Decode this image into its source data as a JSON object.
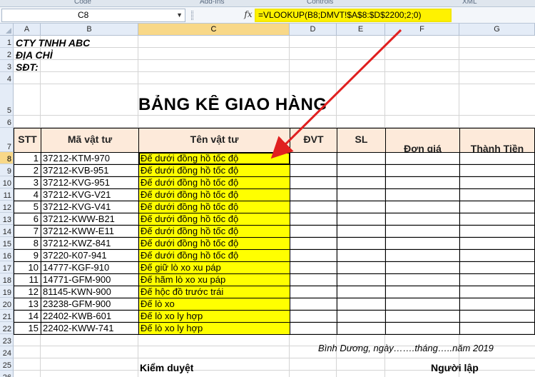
{
  "ribbon": {
    "groups": [
      "Code",
      "Add-Ins",
      "Controls",
      "XML"
    ]
  },
  "formula_bar": {
    "name_box": "C8",
    "fx_label": "fx",
    "formula": "=VLOOKUP(B8;DMVT!$A$8:$D$2200;2;0)"
  },
  "columns": [
    "A",
    "B",
    "C",
    "D",
    "E",
    "F",
    "G"
  ],
  "rows": [
    "1",
    "2",
    "3",
    "4",
    "5",
    "6",
    "7",
    "8",
    "9",
    "10",
    "11",
    "12",
    "13",
    "14",
    "15",
    "16",
    "17",
    "18",
    "19",
    "20",
    "21",
    "22",
    "23",
    "24",
    "25",
    "26"
  ],
  "company": {
    "name": "CTY TNHH ABC",
    "address": "ĐỊA CHỈ",
    "phone": "SĐT:"
  },
  "title": "BẢNG KÊ GIAO HÀNG",
  "table_headers": {
    "stt": "STT",
    "code": "Mã vật tư",
    "name": "Tên vật tư",
    "unit": "ĐVT",
    "qty": "SL",
    "price": "Đơn giá",
    "total": "Thành Tiền"
  },
  "items": [
    {
      "stt": "1",
      "code": "37212-KTM-970",
      "name": "Đế dưới đồng hồ tốc độ"
    },
    {
      "stt": "2",
      "code": "37212-KVB-951",
      "name": "Đế dưới đồng hồ tốc độ"
    },
    {
      "stt": "3",
      "code": "37212-KVG-951",
      "name": "Đế dưới đồng hồ tốc độ"
    },
    {
      "stt": "4",
      "code": "37212-KVG-V21",
      "name": "Đế dưới đồng hồ tốc độ"
    },
    {
      "stt": "5",
      "code": "37212-KVG-V41",
      "name": "Đế dưới đồng hồ tốc độ"
    },
    {
      "stt": "6",
      "code": "37212-KWW-B21",
      "name": "Đế dưới đồng hồ tốc độ"
    },
    {
      "stt": "7",
      "code": "37212-KWW-E11",
      "name": "Đế dưới đồng hồ tốc độ"
    },
    {
      "stt": "8",
      "code": "37212-KWZ-841",
      "name": "Đế dưới đồng hồ tốc độ"
    },
    {
      "stt": "9",
      "code": "37220-K07-941",
      "name": "Đế dưới đồng hồ tốc độ"
    },
    {
      "stt": "10",
      "code": "14777-KGF-910",
      "name": "Đế giữ lò xo xu páp"
    },
    {
      "stt": "11",
      "code": "14771-GFM-900",
      "name": "Đế hãm lò xo xu páp"
    },
    {
      "stt": "12",
      "code": "81145-KWN-900",
      "name": "Đế hộc đồ trước trái"
    },
    {
      "stt": "13",
      "code": "23238-GFM-900",
      "name": "Đế lò xo"
    },
    {
      "stt": "14",
      "code": "22402-KWB-601",
      "name": "Đế lò xo ly hợp"
    },
    {
      "stt": "15",
      "code": "22402-KWW-741",
      "name": "Đế lò xo ly hợp"
    }
  ],
  "footer": {
    "date_line": "Bình Dương, ngày…….tháng…..năm 2019",
    "reviewer": "Kiểm duyệt",
    "preparer": "Người lập"
  },
  "colors": {
    "highlight": "#ffff00",
    "header_fill": "#fdeada",
    "arrow": "#e02020"
  }
}
